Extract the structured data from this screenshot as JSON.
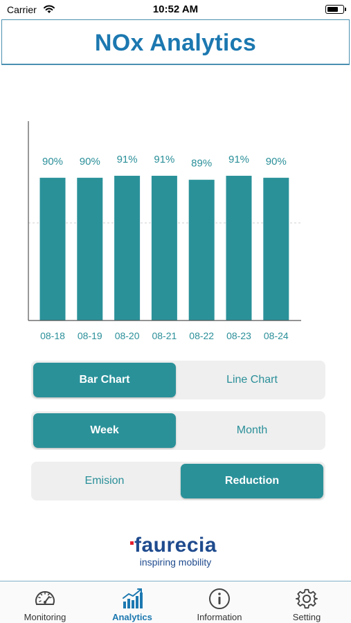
{
  "status_bar": {
    "carrier": "Carrier",
    "time": "10:52 AM"
  },
  "header": {
    "title": "NOx Analytics"
  },
  "chart_data": {
    "type": "bar",
    "categories": [
      "08-18",
      "08-19",
      "08-20",
      "08-21",
      "08-22",
      "08-23",
      "08-24"
    ],
    "values": [
      90,
      90,
      91,
      91,
      89,
      91,
      90
    ],
    "value_labels": [
      "90%",
      "90%",
      "91%",
      "91%",
      "89%",
      "91%",
      "90%"
    ],
    "ylim": [
      0,
      100
    ],
    "grid": "dashed midline",
    "color": "#2a9199",
    "label_color": "#2a8f99"
  },
  "controls": {
    "chart_type": {
      "options": [
        "Bar Chart",
        "Line Chart"
      ],
      "selected": "Bar Chart"
    },
    "period": {
      "options": [
        "Week",
        "Month"
      ],
      "selected": "Week"
    },
    "metric": {
      "options": [
        "Emision",
        "Reduction"
      ],
      "selected": "Reduction"
    }
  },
  "logo": {
    "name": "faurecia",
    "tagline": "inspiring mobility"
  },
  "tabbar": {
    "items": [
      {
        "label": "Monitoring",
        "icon": "speedometer-icon"
      },
      {
        "label": "Analytics",
        "icon": "bar-chart-icon"
      },
      {
        "label": "Information",
        "icon": "info-icon"
      },
      {
        "label": "Setting",
        "icon": "gear-icon"
      }
    ],
    "active": "Analytics"
  },
  "colors": {
    "accent": "#2a9199",
    "title": "#1c78b0",
    "brand": "#1f4b8e"
  }
}
